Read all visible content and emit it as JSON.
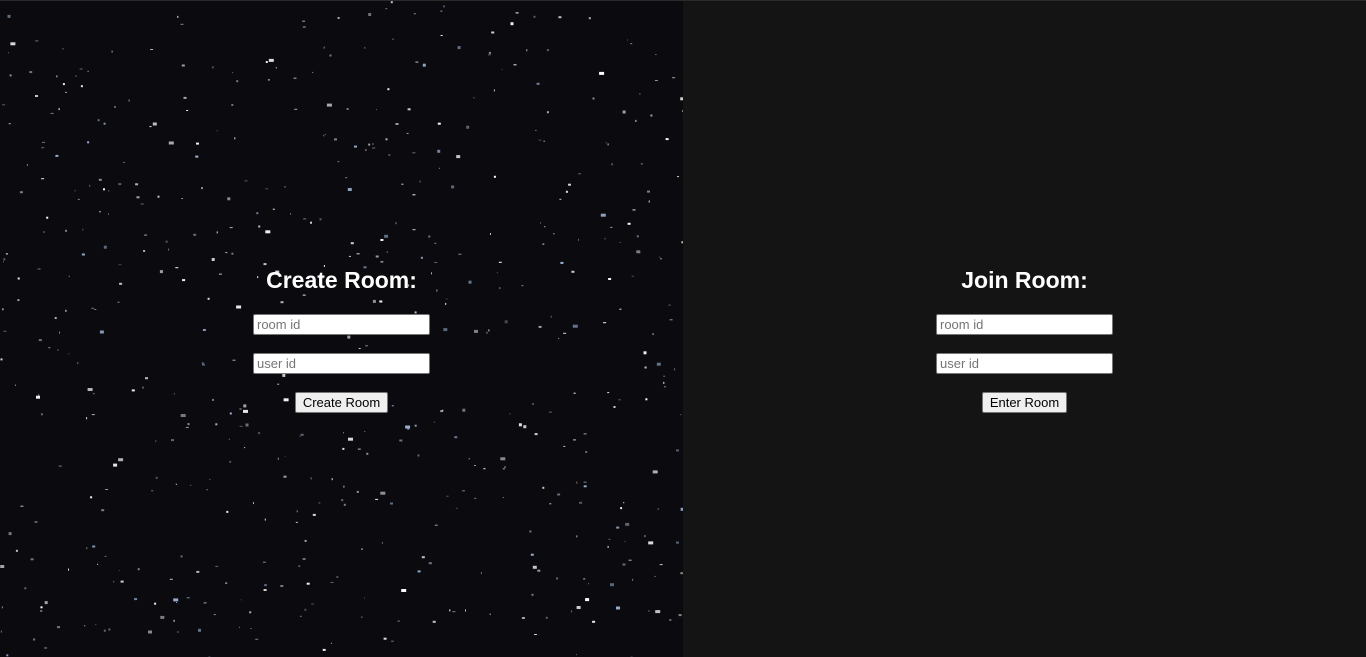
{
  "create_room": {
    "heading": "Create Room:",
    "room_id_placeholder": "room id",
    "room_id_value": "",
    "user_id_placeholder": "user id",
    "user_id_value": "",
    "button_label": "Create Room"
  },
  "join_room": {
    "heading": "Join Room:",
    "room_id_placeholder": "room id",
    "room_id_value": "",
    "user_id_placeholder": "user id",
    "user_id_value": "",
    "button_label": "Enter Room"
  },
  "colors": {
    "create_background": "#0b0a0f",
    "join_background": "#141414",
    "heading_text": "#ffffff",
    "star": "#ffffff",
    "star_tint": "#9fb8d8"
  }
}
